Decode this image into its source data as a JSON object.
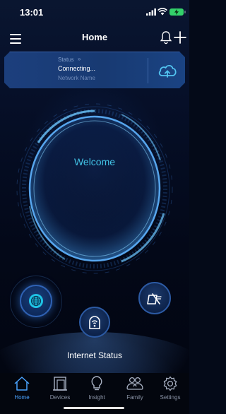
{
  "status_bar": {
    "time": "13:01"
  },
  "header": {
    "title": "Home"
  },
  "status_card": {
    "status_label": "Status",
    "status_chevron": "»",
    "connection_text": "Connecting...",
    "network_name": "Network Name"
  },
  "main": {
    "welcome_text": "Welcome",
    "internet_status": "Internet Status"
  },
  "tabs": [
    {
      "label": "Home",
      "icon": "home-icon",
      "active": true
    },
    {
      "label": "Devices",
      "icon": "devices-icon",
      "active": false
    },
    {
      "label": "Insight",
      "icon": "lightbulb-icon",
      "active": false
    },
    {
      "label": "Family",
      "icon": "family-icon",
      "active": false
    },
    {
      "label": "Settings",
      "icon": "gear-icon",
      "active": false
    }
  ],
  "colors": {
    "accent": "#42c3e6",
    "tab_active": "#4aa3ff",
    "card": "#1c3f7d"
  }
}
